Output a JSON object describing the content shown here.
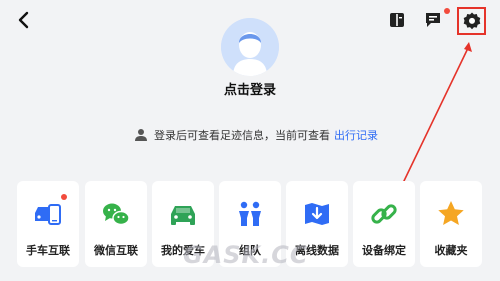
{
  "profile": {
    "login_title": "点击登录"
  },
  "notice": {
    "text": "登录后可查看足迹信息，当前可查看",
    "link": "出行记录"
  },
  "tiles": [
    {
      "label": "手车互联",
      "icon": "phone-car-icon",
      "badge": true
    },
    {
      "label": "微信互联",
      "icon": "wechat-icon",
      "badge": false
    },
    {
      "label": "我的爱车",
      "icon": "car-icon",
      "badge": false
    },
    {
      "label": "组队",
      "icon": "team-icon",
      "badge": false
    },
    {
      "label": "离线数据",
      "icon": "offline-map-icon",
      "badge": false
    },
    {
      "label": "设备绑定",
      "icon": "link-icon",
      "badge": false
    },
    {
      "label": "收藏夹",
      "icon": "star-icon",
      "badge": false
    }
  ],
  "header": {
    "icons": [
      "back-icon",
      "book-icon",
      "message-icon",
      "settings-icon"
    ],
    "message_badge": true
  },
  "watermark": "GASK.CC",
  "colors": {
    "accent_blue": "#2f6cf5",
    "wechat_green": "#36b24a",
    "car_green": "#2fa357",
    "team_blue": "#2f6cf5",
    "star_orange": "#f5a623",
    "highlight_red": "#e5332a"
  }
}
